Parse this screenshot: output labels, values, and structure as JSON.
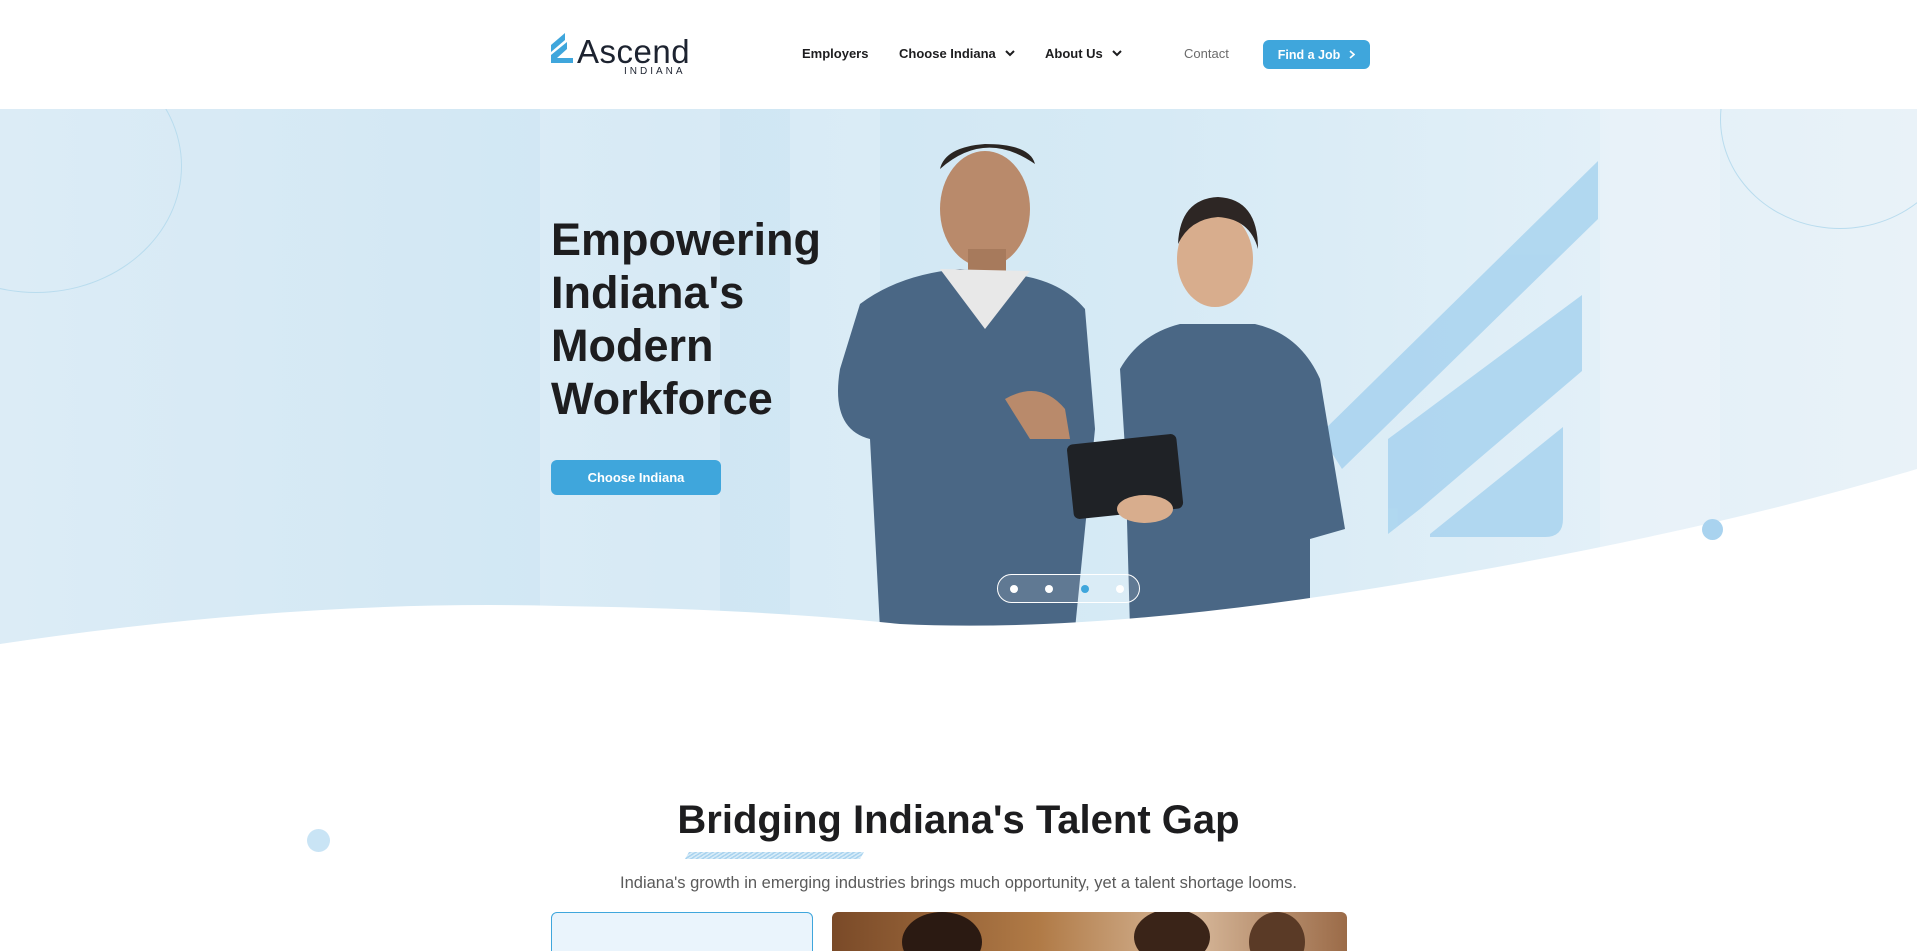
{
  "header": {
    "logo_text": "Ascend",
    "logo_sub": "INDIANA",
    "nav": {
      "employers": "Employers",
      "choose_indiana": "Choose Indiana",
      "about_us": "About Us",
      "contact": "Contact"
    },
    "find_job_label": "Find a Job"
  },
  "hero": {
    "title_lines": [
      "Empowering",
      "Indiana's",
      "Modern",
      "Workforce"
    ],
    "cta_label": "Choose Indiana",
    "slider_active_index": 2,
    "slider_count": 4
  },
  "section": {
    "title": "Bridging Indiana's Talent Gap",
    "subtitle": "Indiana's growth in emerging industries brings much opportunity, yet a talent shortage looms."
  },
  "colors": {
    "accent": "#3fa6dc",
    "hero_bg": "#d6eaf5",
    "text": "#1d1d1f"
  },
  "icons": {
    "logo_mark": "ascend-logo-mark",
    "dropdown": "chevron-down-icon",
    "arrow": "chevron-right-icon"
  }
}
